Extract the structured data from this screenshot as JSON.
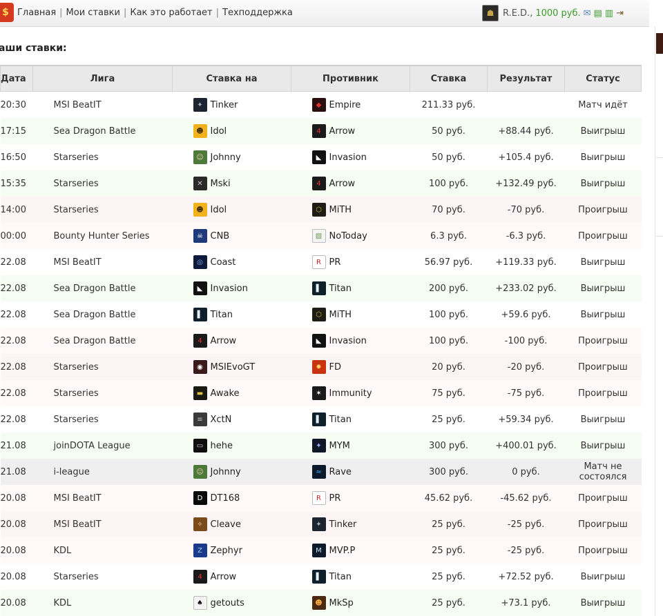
{
  "nav": {
    "items": [
      "Главная",
      "Мои ставки",
      "Как это работает",
      "Техподдержка"
    ]
  },
  "user": {
    "name": "R.E.D.,",
    "balance": "1000 руб."
  },
  "page_title": "аши ставки:",
  "table": {
    "headers": [
      "Дата",
      "Лига",
      "Ставка на",
      "Противник",
      "Ставка",
      "Результат",
      "Статус"
    ],
    "rows": [
      {
        "date": "20:30",
        "league": "MSI BeatIT",
        "team": "Tinker",
        "team_icon": "tinker-icon",
        "opp": "Empire",
        "opp_icon": "empire-icon",
        "stake": "211.33 руб.",
        "result": "",
        "status": "Матч идёт",
        "kind": "live"
      },
      {
        "date": "17:15",
        "league": "Sea Dragon Battle",
        "team": "Idol",
        "team_icon": "idol-icon",
        "opp": "Arrow",
        "opp_icon": "arrow-icon",
        "stake": "50 руб.",
        "result": "+88.44 руб.",
        "status": "Выигрыш",
        "kind": "win"
      },
      {
        "date": "16:50",
        "league": "Starseries",
        "team": "Johnny",
        "team_icon": "johnny-icon",
        "opp": "Invasion",
        "opp_icon": "invasion-icon",
        "stake": "50 руб.",
        "result": "+105.4 руб.",
        "status": "Выигрыш",
        "kind": "win"
      },
      {
        "date": "15:35",
        "league": "Starseries",
        "team": "Mski",
        "team_icon": "mski-icon",
        "opp": "Arrow",
        "opp_icon": "arrow-icon",
        "stake": "100 руб.",
        "result": "+132.49 руб.",
        "status": "Выигрыш",
        "kind": "win"
      },
      {
        "date": "14:00",
        "league": "Starseries",
        "team": "Idol",
        "team_icon": "idol-icon",
        "opp": "MiTH",
        "opp_icon": "mith-icon",
        "stake": "70 руб.",
        "result": "-70 руб.",
        "status": "Проигрыш",
        "kind": "lose"
      },
      {
        "date": "00:00",
        "league": "Bounty Hunter Series",
        "team": "CNB",
        "team_icon": "cnb-icon",
        "opp": "NoToday",
        "opp_icon": "broken-image-icon",
        "stake": "6.3 руб.",
        "result": "-6.3 руб.",
        "status": "Проигрыш",
        "kind": "lose"
      },
      {
        "date": "22.08",
        "league": "MSI BeatIT",
        "team": "Coast",
        "team_icon": "coast-icon",
        "opp": "PR",
        "opp_icon": "pr-icon",
        "stake": "56.97 руб.",
        "result": "+119.33 руб.",
        "status": "Выигрыш",
        "kind": "win"
      },
      {
        "date": "22.08",
        "league": "Sea Dragon Battle",
        "team": "Invasion",
        "team_icon": "invasion-icon",
        "opp": "Titan",
        "opp_icon": "titan-icon",
        "stake": "200 руб.",
        "result": "+233.02 руб.",
        "status": "Выигрыш",
        "kind": "win"
      },
      {
        "date": "22.08",
        "league": "Sea Dragon Battle",
        "team": "Titan",
        "team_icon": "titan-icon",
        "opp": "MiTH",
        "opp_icon": "mith-icon",
        "stake": "100 руб.",
        "result": "+59.6 руб.",
        "status": "Выигрыш",
        "kind": "win"
      },
      {
        "date": "22.08",
        "league": "Sea Dragon Battle",
        "team": "Arrow",
        "team_icon": "arrow-icon",
        "opp": "Invasion",
        "opp_icon": "invasion-icon",
        "stake": "100 руб.",
        "result": "-100 руб.",
        "status": "Проигрыш",
        "kind": "lose"
      },
      {
        "date": "22.08",
        "league": "Starseries",
        "team": "MSIEvoGT",
        "team_icon": "msievogt-icon",
        "opp": "FD",
        "opp_icon": "fd-icon",
        "stake": "20 руб.",
        "result": "-20 руб.",
        "status": "Проигрыш",
        "kind": "lose"
      },
      {
        "date": "22.08",
        "league": "Starseries",
        "team": "Awake",
        "team_icon": "awake-icon",
        "opp": "Immunity",
        "opp_icon": "immunity-icon",
        "stake": "75 руб.",
        "result": "-75 руб.",
        "status": "Проигрыш",
        "kind": "lose"
      },
      {
        "date": "22.08",
        "league": "Starseries",
        "team": "XctN",
        "team_icon": "xctn-icon",
        "opp": "Titan",
        "opp_icon": "titan-icon",
        "stake": "25 руб.",
        "result": "+59.34 руб.",
        "status": "Выигрыш",
        "kind": "win"
      },
      {
        "date": "21.08",
        "league": "joinDOTA League",
        "team": "hehe",
        "team_icon": "hehe-icon",
        "opp": "MYM",
        "opp_icon": "mym-icon",
        "stake": "300 руб.",
        "result": "+400.01 руб.",
        "status": "Выигрыш",
        "kind": "win"
      },
      {
        "date": "21.08",
        "league": "i-league",
        "team": "Johnny",
        "team_icon": "johnny-icon",
        "opp": "Rave",
        "opp_icon": "rave-icon",
        "stake": "300 руб.",
        "result": "0 руб.",
        "status": "Матч не состоялся",
        "kind": "void"
      },
      {
        "date": "20.08",
        "league": "MSI BeatIT",
        "team": "DT168",
        "team_icon": "dt168-icon",
        "opp": "PR",
        "opp_icon": "pr-icon",
        "stake": "45.62 руб.",
        "result": "-45.62 руб.",
        "status": "Проигрыш",
        "kind": "lose"
      },
      {
        "date": "20.08",
        "league": "MSI BeatIT",
        "team": "Cleave",
        "team_icon": "cleave-icon",
        "opp": "Tinker",
        "opp_icon": "tinker-icon",
        "stake": "25 руб.",
        "result": "-25 руб.",
        "status": "Проигрыш",
        "kind": "lose"
      },
      {
        "date": "20.08",
        "league": "KDL",
        "team": "Zephyr",
        "team_icon": "zephyr-icon",
        "opp": "MVP.P",
        "opp_icon": "mvpp-icon",
        "stake": "25 руб.",
        "result": "-25 руб.",
        "status": "Проигрыш",
        "kind": "lose"
      },
      {
        "date": "20.08",
        "league": "Starseries",
        "team": "Arrow",
        "team_icon": "arrow-icon",
        "opp": "Titan",
        "opp_icon": "titan-icon",
        "stake": "25 руб.",
        "result": "+72.52 руб.",
        "status": "Выигрыш",
        "kind": "win"
      },
      {
        "date": "20.08",
        "league": "KDL",
        "team": "getouts",
        "team_icon": "getouts-icon",
        "opp": "MkSp",
        "opp_icon": "mksp-icon",
        "stake": "25 руб.",
        "result": "+73.1 руб.",
        "status": "Выигрыш",
        "kind": "win"
      }
    ]
  },
  "icon_styles": {
    "tinker-icon": {
      "bg": "#1c2430",
      "fg": "#9fb3c8",
      "glyph": "✦"
    },
    "empire-icon": {
      "bg": "#2a0f0f",
      "fg": "#d33",
      "glyph": "◆"
    },
    "idol-icon": {
      "bg": "#f2b21c",
      "fg": "#3a2a00",
      "glyph": "☻"
    },
    "arrow-icon": {
      "bg": "#1a1a1a",
      "fg": "#e33",
      "glyph": "4"
    },
    "johnny-icon": {
      "bg": "#4d7a3a",
      "fg": "#f0d0a8",
      "glyph": "☺"
    },
    "invasion-icon": {
      "bg": "#111111",
      "fg": "#ffffff",
      "glyph": "◣"
    },
    "mski-icon": {
      "bg": "#2a2a2a",
      "fg": "#c8c8c8",
      "glyph": "✕"
    },
    "mith-icon": {
      "bg": "#1d1d14",
      "fg": "#d4b43a",
      "glyph": "⬡"
    },
    "cnb-icon": {
      "bg": "#1e3a7a",
      "fg": "#ffffff",
      "glyph": "☠"
    },
    "broken-image-icon": {
      "bg": "#f4f4f4",
      "fg": "#6a9a4a",
      "glyph": "▨"
    },
    "coast-icon": {
      "bg": "#0d1a3a",
      "fg": "#6ab0ff",
      "glyph": "◎"
    },
    "pr-icon": {
      "bg": "#ffffff",
      "fg": "#c22",
      "glyph": "R"
    },
    "titan-icon": {
      "bg": "#10202a",
      "fg": "#e8f2ff",
      "glyph": "▌"
    },
    "msievogt-icon": {
      "bg": "#3a1a1a",
      "fg": "#ffffff",
      "glyph": "◉"
    },
    "fd-icon": {
      "bg": "#c8320f",
      "fg": "#ffd06a",
      "glyph": "✹"
    },
    "awake-icon": {
      "bg": "#1a1a12",
      "fg": "#e0c040",
      "glyph": "▬"
    },
    "immunity-icon": {
      "bg": "#1a1a1a",
      "fg": "#ffffff",
      "glyph": "✶"
    },
    "xctn-icon": {
      "bg": "#3a3a3a",
      "fg": "#c0c0c0",
      "glyph": "≡"
    },
    "hehe-icon": {
      "bg": "#0e0e0e",
      "fg": "#d0d0d0",
      "glyph": "▭"
    },
    "mym-icon": {
      "bg": "#101828",
      "fg": "#9ab0ff",
      "glyph": "✦"
    },
    "rave-icon": {
      "bg": "#0a1a2a",
      "fg": "#3ab0ff",
      "glyph": "≈"
    },
    "dt168-icon": {
      "bg": "#0a0a0a",
      "fg": "#ffffff",
      "glyph": "D"
    },
    "cleave-icon": {
      "bg": "#7a4a1a",
      "fg": "#ffd89a",
      "glyph": "✧"
    },
    "zephyr-icon": {
      "bg": "#1a3a8a",
      "fg": "#9ad0ff",
      "glyph": "Z"
    },
    "mvpp-icon": {
      "bg": "#0e1a2a",
      "fg": "#bfe0ff",
      "glyph": "M"
    },
    "getouts-icon": {
      "bg": "#f4f4f4",
      "fg": "#111111",
      "glyph": "♠"
    },
    "mksp-icon": {
      "bg": "#4a2a12",
      "fg": "#ffb040",
      "glyph": "☻"
    }
  }
}
